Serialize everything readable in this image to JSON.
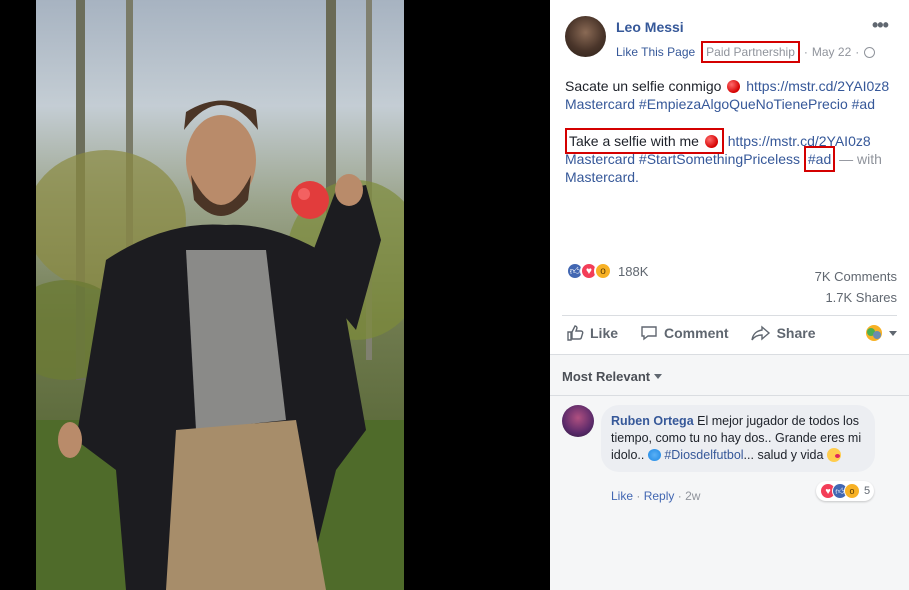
{
  "post": {
    "author": "Leo Messi",
    "like_page": "Like This Page",
    "paid_partnership": "Paid Partnership",
    "sep": "·",
    "date": "May 22",
    "text_es": "Sacate un selfie conmigo",
    "link_es": "https://mstr.cd/2YAI0z8",
    "tags_es": "Mastercard #EmpiezaAlgoQueNoTienePrecio #ad",
    "text_en": "Take a selfie with me",
    "link_en": "https://mstr.cd/2YAI0z8",
    "tags_en_1": "Mastercard #StartSomethingPriceless",
    "tag_ad": "#ad",
    "with": "— with",
    "with_page": "Mastercard."
  },
  "stats": {
    "reactions": "188K",
    "comments": "7K Comments",
    "shares": "1.7K Shares"
  },
  "actions": {
    "like": "Like",
    "comment": "Comment",
    "share": "Share"
  },
  "comments": {
    "sort": "Most Relevant",
    "items": [
      {
        "name": "Ruben Ortega",
        "text_1": "El mejor jugador de todos los tiempo, como tu no hay dos.. Grande eres mi idolo..",
        "tag": "#Diosdelfutbol",
        "text_2": "... salud y vida",
        "reaction_count": "5",
        "like": "Like",
        "reply": "Reply",
        "age": "2w"
      }
    ]
  },
  "colors": {
    "link": "#365899",
    "highlight_box": "#d40000",
    "like_blue": "#4267b2",
    "love_red": "#f33e58"
  },
  "icons": [
    "more-options-icon",
    "globe-icon",
    "like-icon",
    "comment-icon",
    "share-icon",
    "audience-selector-icon"
  ]
}
